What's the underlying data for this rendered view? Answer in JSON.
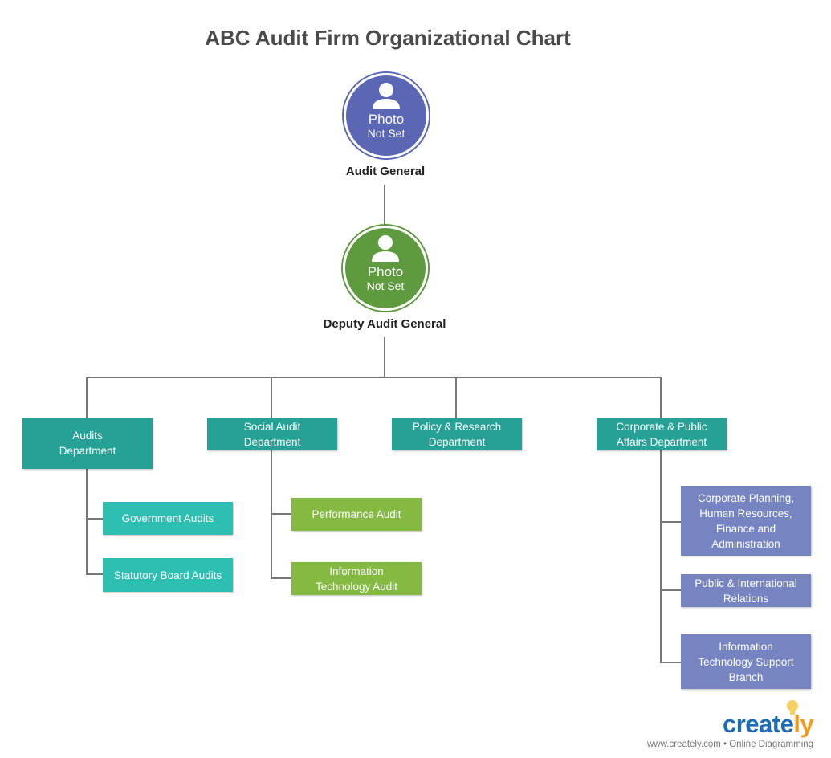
{
  "title": "ABC Audit Firm Organizational Chart",
  "top": {
    "photo1": "Photo",
    "photo2": "Not Set",
    "role": "Audit General",
    "color": "#5b67b4"
  },
  "deputy": {
    "photo1": "Photo",
    "photo2": "Not Set",
    "role": "Deputy Audit General",
    "color": "#5e9a3e"
  },
  "departments": [
    "Audits\nDepartment",
    "Social Audit\nDepartment",
    "Policy & Research\nDepartment",
    "Corporate & Public\nAffairs Department"
  ],
  "audits_units": [
    "Government Audits",
    "Statutory Board Audits"
  ],
  "social_units": [
    "Performance Audit",
    "Information\nTechnology Audit"
  ],
  "corporate_units": [
    "Corporate Planning,\nHuman Resources,\nFinance and\nAdministration",
    "Public & International\nRelations",
    "Information\nTechnology Support\nBranch"
  ],
  "branding": {
    "logo_main": "create",
    "logo_end": "ly",
    "tagline": "www.creately.com • Online Diagramming"
  },
  "colors": {
    "department": "#26a195",
    "audits_unit": "#2dbfb2",
    "social_unit": "#84b942",
    "corporate_unit": "#7784c2",
    "connector": "#777777"
  }
}
